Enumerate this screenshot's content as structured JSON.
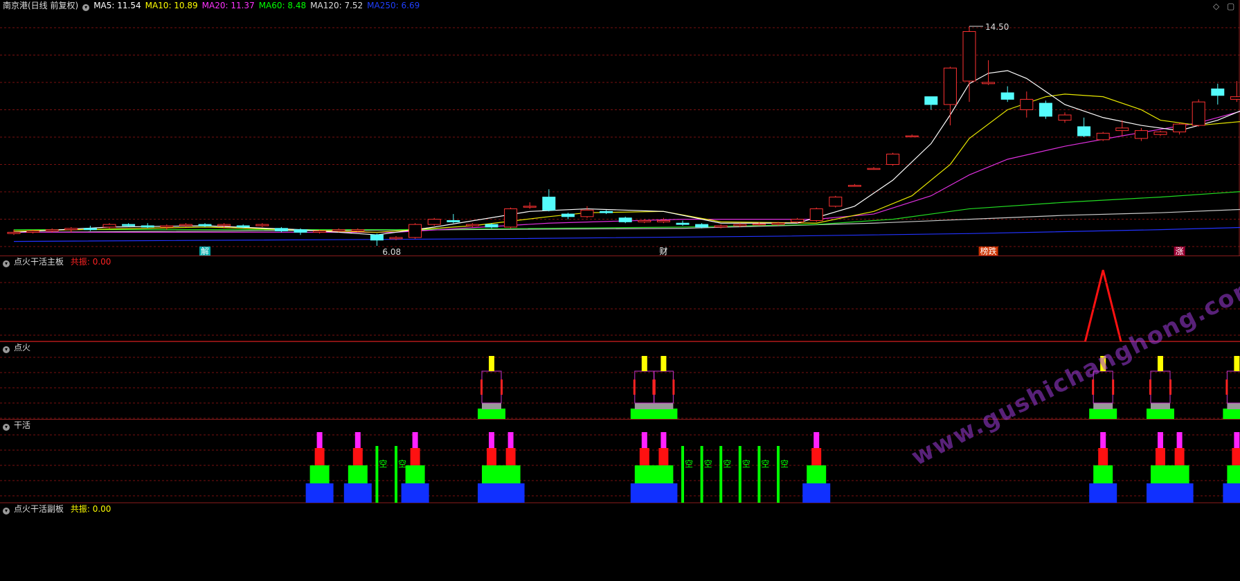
{
  "main": {
    "stock_name": "南京港(日线 前复权)",
    "ma": [
      {
        "label": "MA5: 11.54",
        "color": "#ffffff"
      },
      {
        "label": "MA10: 10.89",
        "color": "#ffff00"
      },
      {
        "label": "MA20: 11.37",
        "color": "#ff33ff"
      },
      {
        "label": "MA60: 8.48",
        "color": "#00ff00"
      },
      {
        "label": "MA120: 7.52",
        "color": "#dddddd"
      },
      {
        "label": "MA250: 6.69",
        "color": "#1f3fff"
      }
    ],
    "high_label": "14.50",
    "low_label": "6.08",
    "event_markers": [
      {
        "text": "解",
        "bg": "#00aaaa",
        "color": "#ffffff",
        "slot": 10
      },
      {
        "text": "财",
        "bg": "#000000",
        "color": "#ffffff",
        "slot": 34
      },
      {
        "text": "榜跌",
        "bg": "#cc3300",
        "color": "#ffffff",
        "slot": 51
      },
      {
        "text": "涨",
        "bg": "#990033",
        "color": "#ffffff",
        "slot": 61
      }
    ],
    "corner_icons": [
      "diamond-icon",
      "maximize-icon"
    ]
  },
  "panel1": {
    "title": "点火干活主板",
    "value_label": "共振: 0.00",
    "value_color": "#ff2222"
  },
  "panel2": {
    "title": "点火"
  },
  "panel3": {
    "title": "干活",
    "empty_label": "空"
  },
  "panel4": {
    "title": "点火干活副板",
    "value_label": "共振: 0.00"
  },
  "watermark": "www.gushichanghong.com",
  "colors": {
    "up": "#ff3232",
    "down": "#54fcfc",
    "grid": "#7a1010",
    "frame": "#8b1c1c"
  },
  "chart_data": {
    "type": "candlestick",
    "price_range": [
      6.08,
      14.5
    ],
    "candles": [
      [
        6.55,
        6.6,
        6.7,
        6.5
      ],
      [
        6.6,
        6.65,
        6.7,
        6.55
      ],
      [
        6.65,
        6.7,
        6.75,
        6.6
      ],
      [
        6.7,
        6.75,
        6.8,
        6.6
      ],
      [
        6.75,
        6.7,
        6.85,
        6.65
      ],
      [
        6.8,
        6.9,
        6.95,
        6.75
      ],
      [
        6.9,
        6.85,
        6.95,
        6.8
      ],
      [
        6.85,
        6.8,
        6.95,
        6.75
      ],
      [
        6.8,
        6.85,
        6.9,
        6.7
      ],
      [
        6.85,
        6.9,
        6.95,
        6.8
      ],
      [
        6.9,
        6.85,
        6.95,
        6.8
      ],
      [
        6.85,
        6.9,
        6.95,
        6.75
      ],
      [
        6.85,
        6.8,
        6.9,
        6.75
      ],
      [
        6.85,
        6.9,
        6.95,
        6.8
      ],
      [
        6.75,
        6.65,
        6.8,
        6.6
      ],
      [
        6.7,
        6.6,
        6.75,
        6.5
      ],
      [
        6.6,
        6.65,
        6.7,
        6.55
      ],
      [
        6.65,
        6.7,
        6.75,
        6.6
      ],
      [
        6.65,
        6.7,
        6.75,
        6.6
      ],
      [
        6.5,
        6.3,
        6.55,
        6.08
      ],
      [
        6.35,
        6.4,
        6.45,
        6.3
      ],
      [
        6.4,
        6.9,
        6.95,
        6.35
      ],
      [
        6.9,
        7.1,
        7.15,
        6.85
      ],
      [
        7.05,
        7.0,
        7.3,
        6.95
      ],
      [
        6.85,
        6.9,
        6.95,
        6.8
      ],
      [
        6.9,
        6.8,
        6.95,
        6.75
      ],
      [
        6.8,
        7.5,
        7.55,
        6.75
      ],
      [
        7.6,
        7.6,
        7.75,
        7.5
      ],
      [
        7.95,
        7.45,
        8.25,
        7.4
      ],
      [
        7.3,
        7.2,
        7.35,
        7.1
      ],
      [
        7.2,
        7.45,
        7.6,
        7.15
      ],
      [
        7.4,
        7.35,
        7.45,
        7.3
      ],
      [
        7.15,
        7.0,
        7.2,
        6.95
      ],
      [
        7.0,
        7.05,
        7.1,
        6.95
      ],
      [
        7.0,
        7.05,
        7.15,
        6.95
      ],
      [
        6.95,
        6.9,
        7.05,
        6.85
      ],
      [
        6.9,
        6.8,
        6.95,
        6.75
      ],
      [
        6.8,
        6.85,
        6.9,
        6.75
      ],
      [
        6.85,
        6.9,
        6.95,
        6.8
      ],
      [
        6.9,
        6.92,
        6.98,
        6.85
      ],
      [
        6.9,
        6.95,
        7.0,
        6.85
      ],
      [
        7.0,
        7.1,
        7.15,
        6.95
      ],
      [
        7.05,
        7.5,
        7.55,
        7.0
      ],
      [
        7.6,
        7.95,
        8.0,
        7.55
      ],
      [
        8.4,
        8.4,
        8.45,
        8.35
      ],
      [
        9.05,
        9.05,
        9.1,
        9.0
      ],
      [
        9.2,
        9.6,
        9.65,
        9.15
      ],
      [
        10.3,
        10.3,
        10.35,
        10.25
      ],
      [
        11.8,
        11.5,
        11.8,
        11.3
      ],
      [
        11.5,
        12.9,
        12.95,
        10.7
      ],
      [
        12.4,
        14.3,
        14.5,
        11.6
      ],
      [
        12.3,
        12.35,
        13.2,
        12.25
      ],
      [
        11.95,
        11.7,
        12.2,
        11.6
      ],
      [
        11.3,
        11.7,
        12.0,
        11.0
      ],
      [
        11.55,
        11.05,
        11.65,
        10.95
      ],
      [
        10.9,
        11.1,
        11.2,
        10.8
      ],
      [
        10.65,
        10.3,
        11.0,
        10.25
      ],
      [
        10.15,
        10.4,
        10.45,
        10.1
      ],
      [
        10.5,
        10.6,
        10.9,
        10.3
      ],
      [
        10.2,
        10.5,
        10.6,
        10.1
      ],
      [
        10.35,
        10.45,
        10.5,
        10.3
      ],
      [
        10.45,
        10.75,
        10.8,
        10.35
      ],
      [
        10.7,
        11.6,
        11.7,
        10.65
      ],
      [
        12.1,
        11.85,
        12.3,
        11.5
      ],
      [
        11.7,
        11.8,
        12.4,
        11.6
      ],
      [
        11.35,
        11.85,
        12.55,
        11.2
      ]
    ],
    "ma5": [
      [
        0,
        6.6
      ],
      [
        5,
        6.8
      ],
      [
        10,
        6.85
      ],
      [
        15,
        6.7
      ],
      [
        19,
        6.5
      ],
      [
        22,
        6.8
      ],
      [
        27,
        7.4
      ],
      [
        30,
        7.5
      ],
      [
        34,
        7.4
      ],
      [
        37,
        6.95
      ],
      [
        41,
        6.95
      ],
      [
        44,
        7.6
      ],
      [
        46,
        8.6
      ],
      [
        48,
        10.0
      ],
      [
        49,
        11.1
      ],
      [
        50,
        12.3
      ],
      [
        51,
        12.7
      ],
      [
        52,
        12.8
      ],
      [
        53,
        12.5
      ],
      [
        54,
        12.0
      ],
      [
        55,
        11.5
      ],
      [
        57,
        11.0
      ],
      [
        59,
        10.7
      ],
      [
        61,
        10.5
      ],
      [
        63,
        10.9
      ],
      [
        65,
        11.5
      ]
    ],
    "ma10": [
      [
        0,
        6.65
      ],
      [
        10,
        6.8
      ],
      [
        19,
        6.6
      ],
      [
        24,
        6.85
      ],
      [
        28,
        7.2
      ],
      [
        30,
        7.35
      ],
      [
        34,
        7.4
      ],
      [
        37,
        7.0
      ],
      [
        42,
        6.95
      ],
      [
        45,
        7.4
      ],
      [
        47,
        8.0
      ],
      [
        49,
        9.2
      ],
      [
        50,
        10.2
      ],
      [
        52,
        11.3
      ],
      [
        54,
        11.8
      ],
      [
        55,
        11.9
      ],
      [
        57,
        11.8
      ],
      [
        59,
        11.3
      ],
      [
        60,
        10.9
      ],
      [
        62,
        10.7
      ],
      [
        65,
        10.9
      ]
    ],
    "ma20": [
      [
        0,
        6.6
      ],
      [
        20,
        6.6
      ],
      [
        28,
        6.95
      ],
      [
        35,
        7.1
      ],
      [
        42,
        7.1
      ],
      [
        45,
        7.3
      ],
      [
        48,
        8.0
      ],
      [
        50,
        8.8
      ],
      [
        52,
        9.4
      ],
      [
        55,
        9.9
      ],
      [
        58,
        10.3
      ],
      [
        62,
        10.8
      ],
      [
        65,
        11.4
      ]
    ],
    "ma60": [
      [
        0,
        6.7
      ],
      [
        20,
        6.7
      ],
      [
        35,
        6.8
      ],
      [
        42,
        6.9
      ],
      [
        46,
        7.1
      ],
      [
        50,
        7.5
      ],
      [
        55,
        7.75
      ],
      [
        60,
        7.95
      ],
      [
        65,
        8.2
      ]
    ],
    "ma120": [
      [
        0,
        6.6
      ],
      [
        35,
        6.75
      ],
      [
        45,
        6.95
      ],
      [
        50,
        7.1
      ],
      [
        55,
        7.25
      ],
      [
        60,
        7.35
      ],
      [
        65,
        7.5
      ]
    ],
    "ma250": [
      [
        0,
        6.25
      ],
      [
        25,
        6.35
      ],
      [
        40,
        6.45
      ],
      [
        50,
        6.55
      ],
      [
        60,
        6.7
      ],
      [
        65,
        6.8
      ]
    ],
    "resonance_peak_slot": 57,
    "ignite_slots": [
      [
        25
      ],
      [
        33,
        34
      ],
      [
        57
      ],
      [
        60
      ],
      [
        64
      ]
    ],
    "work_slots": [
      [
        16
      ],
      [
        18
      ],
      [
        21
      ],
      [
        25,
        26
      ],
      [
        33,
        34
      ],
      [
        42
      ],
      [
        57
      ],
      [
        60,
        61
      ],
      [
        64
      ]
    ],
    "empty_slots": [
      19,
      20,
      35,
      36,
      37,
      38,
      39,
      40
    ]
  }
}
